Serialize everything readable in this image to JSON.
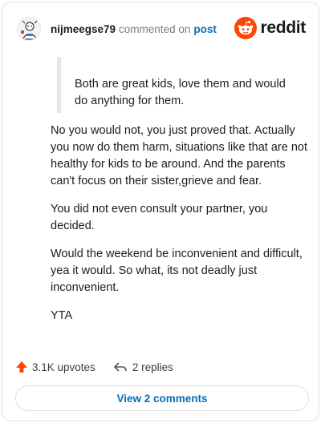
{
  "header": {
    "username": "nijmeegse79",
    "commented_text": "commented on",
    "post_link": "post",
    "brand": "reddit"
  },
  "quote": {
    "text": "Both are great kids, love them and would do anything for them."
  },
  "comment": {
    "paragraphs": [
      "No you would not, you just proved that. Actually you now do them harm, situations like that are not healthy for kids to be around. And the parents can't focus on their sister,grieve and fear.",
      "You did not even consult your partner, you decided.",
      "Would the weekend be inconvenient and difficult, yea it would. So what, its not deadly just inconvenient.",
      "YTA"
    ]
  },
  "footer": {
    "upvotes": "3.1K upvotes",
    "replies": "2 replies"
  },
  "view_comments": "View 2 comments",
  "colors": {
    "upvote_arrow": "#ff4500",
    "link": "#0a6db3",
    "reddit_orange": "#ff4500"
  },
  "icons": {
    "avatar": "avatar-icon",
    "brand_logo": "reddit-logo-icon",
    "upvote": "upvote-arrow-icon",
    "reply": "reply-icon"
  }
}
